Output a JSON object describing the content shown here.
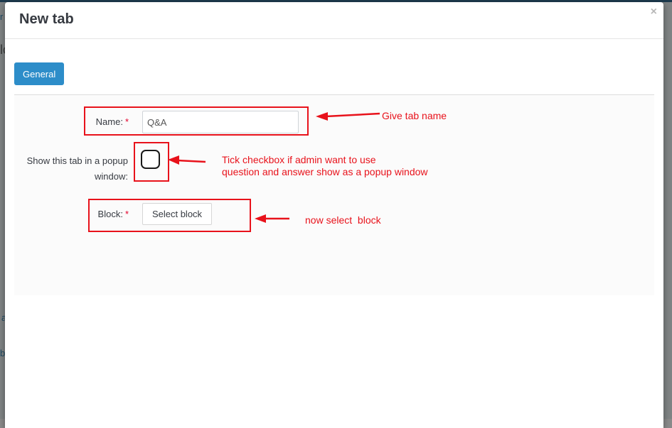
{
  "background": {
    "fragments": [
      "r",
      "lc",
      "a",
      "b"
    ]
  },
  "modal": {
    "title": "New tab",
    "close_glyph": "×",
    "tabs": [
      {
        "label": "General",
        "active": true
      }
    ],
    "form": {
      "name": {
        "label": "Name:",
        "required_mark": "*",
        "value": "Q&A"
      },
      "popup": {
        "label_line1": "Show this tab in a popup",
        "label_line2": "window:",
        "checked": false
      },
      "block": {
        "label": "Block:",
        "required_mark": "*",
        "button_label": "Select block"
      }
    }
  },
  "annotations": {
    "name_note": "Give tab name",
    "checkbox_note_line1": "Tick checkbox if admin want to use",
    "checkbox_note_line2": "question and answer show as a popup window",
    "block_note": "now select  block",
    "color": "#e8121b"
  },
  "colors": {
    "accent": "#2d8dc9",
    "required": "#e3002b",
    "title": "#363a41"
  }
}
